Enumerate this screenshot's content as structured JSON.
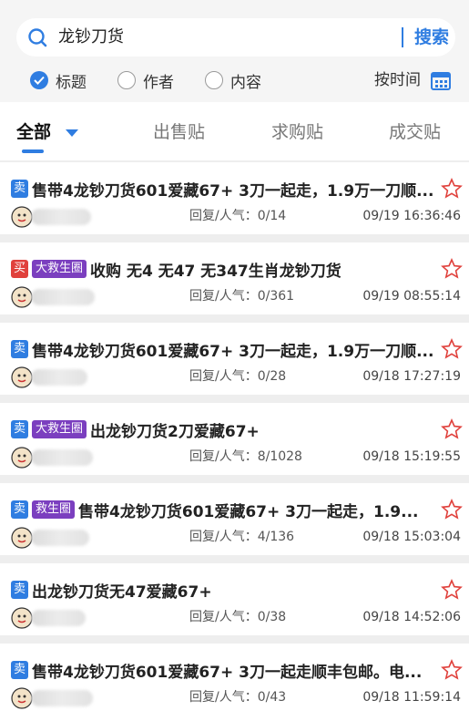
{
  "search": {
    "query": "龙钞刀货",
    "button": "搜索"
  },
  "filters": [
    {
      "label": "标题",
      "checked": true
    },
    {
      "label": "作者",
      "checked": false
    },
    {
      "label": "内容",
      "checked": false
    }
  ],
  "sort": {
    "label": "按时间"
  },
  "tabs": [
    "全部",
    "出售贴",
    "求购贴",
    "成交贴"
  ],
  "colors": {
    "accent": "#2f7de1",
    "sell_badge": "#2f7de1",
    "buy_badge": "#e0413c",
    "tag_badge": "#7b3fbf",
    "star": "#e0413c"
  },
  "posts": [
    {
      "type": "卖",
      "tag": "",
      "title": "售带4龙钞刀货601爱藏67+ 3刀一起走，1.9万一刀顺...",
      "stats": "回复/人气：0/14",
      "date": "09/19 16:36:46"
    },
    {
      "type": "买",
      "tag": "大救生圈",
      "title": "收购 无4 无47 无347生肖龙钞刀货",
      "stats": "回复/人气：0/361",
      "date": "09/19 08:55:14"
    },
    {
      "type": "卖",
      "tag": "",
      "title": "售带4龙钞刀货601爱藏67+ 3刀一起走，1.9万一刀顺...",
      "stats": "回复/人气：0/28",
      "date": "09/18 17:27:19"
    },
    {
      "type": "卖",
      "tag": "大救生圈",
      "title": "出龙钞刀货2刀爱藏67+",
      "stats": "回复/人气：8/1028",
      "date": "09/18 15:19:55"
    },
    {
      "type": "卖",
      "tag": "救生圈",
      "title": "售带4龙钞刀货601爱藏67+ 3刀一起走，1.9...",
      "stats": "回复/人气：4/136",
      "date": "09/18 15:03:04"
    },
    {
      "type": "卖",
      "tag": "",
      "title": "出龙钞刀货无47爱藏67+",
      "stats": "回复/人气：0/38",
      "date": "09/18 14:52:06"
    },
    {
      "type": "卖",
      "tag": "",
      "title": "售带4龙钞刀货601爱藏67+ 3刀一起走顺丰包邮。电...",
      "stats": "回复/人气：0/43",
      "date": "09/18 11:59:14"
    }
  ]
}
